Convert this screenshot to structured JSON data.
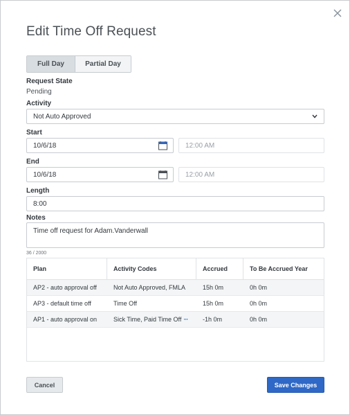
{
  "dialog": {
    "title": "Edit Time Off Request",
    "close_icon": "close-icon"
  },
  "tabs": {
    "full_day": "Full Day",
    "partial_day": "Partial Day",
    "selected": "Full Day"
  },
  "request_state": {
    "label": "Request State",
    "value": "Pending"
  },
  "activity": {
    "label": "Activity",
    "value": "Not Auto Approved"
  },
  "start": {
    "label": "Start",
    "date": "10/6/18",
    "time_placeholder": "12:00 AM"
  },
  "end": {
    "label": "End",
    "date": "10/6/18",
    "time_placeholder": "12:00 AM"
  },
  "length": {
    "label": "Length",
    "value": "8:00"
  },
  "notes": {
    "label": "Notes",
    "value": "Time off request for Adam.Vanderwall",
    "counter": "36 / 2000"
  },
  "table": {
    "headers": [
      "Plan",
      "Activity Codes",
      "Accrued",
      "To Be Accrued Year"
    ],
    "rows": [
      [
        "AP2 - auto approval off",
        "Not Auto Approved, FMLA",
        "15h 0m",
        "0h 0m"
      ],
      [
        "AP3 - default time off",
        "Time Off",
        "15h 0m",
        "0h 0m"
      ],
      [
        "AP1 - auto approval on",
        "Sick Time, Paid Time Off",
        "-1h 0m",
        "0h 0m"
      ]
    ],
    "more_indicator": "···"
  },
  "buttons": {
    "cancel": "Cancel",
    "save": "Save Changes"
  },
  "colors": {
    "primary": "#2f68c6",
    "selected_tab": "#d8dde2"
  }
}
